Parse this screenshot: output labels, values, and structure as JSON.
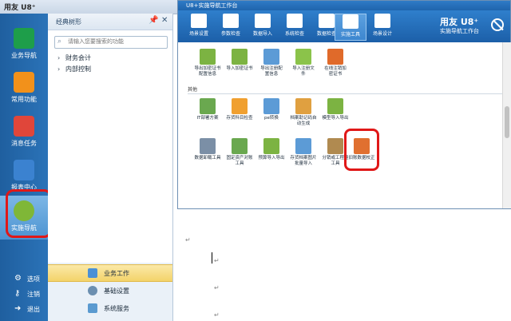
{
  "app": {
    "logo": "用友 U8⁺"
  },
  "rail": {
    "items": [
      {
        "label": "业务导航",
        "icon": "nav-icon",
        "color": "#1e9e4a"
      },
      {
        "label": "常用功能",
        "icon": "star-icon",
        "color": "#f2911b"
      },
      {
        "label": "消息任务",
        "icon": "message-icon",
        "color": "#e0463a"
      },
      {
        "label": "报表中心",
        "icon": "report-icon",
        "color": "#3b82d0"
      },
      {
        "label": "实施导航",
        "icon": "compass-icon",
        "color": "#7fb737"
      }
    ],
    "bottom": [
      {
        "label": "选项",
        "icon": "gear-icon"
      },
      {
        "label": "注销",
        "icon": "key-icon"
      },
      {
        "label": "退出",
        "icon": "exit-icon"
      }
    ]
  },
  "nav": {
    "title": "经典树形",
    "search_placeholder": "请输入您要搜索的功能",
    "tree": [
      {
        "label": "财务会计"
      },
      {
        "label": "内部控制"
      }
    ],
    "bottom": [
      {
        "label": "业务工作",
        "color": "#4a90d6"
      },
      {
        "label": "基础设置",
        "color": "#6b8fb0"
      },
      {
        "label": "系统服务",
        "color": "#5a9ad0"
      }
    ]
  },
  "workbench": {
    "title": "U8+实施导航工作台",
    "brand1": "用友 U8⁺",
    "brand2": "实施导航工作台",
    "toolbar": [
      {
        "label": "场景设置"
      },
      {
        "label": "参数检查"
      },
      {
        "label": "数据导入"
      },
      {
        "label": "系统检查"
      },
      {
        "label": "数据检查"
      },
      {
        "label": "实施工具"
      },
      {
        "label": "场景设计"
      }
    ],
    "tools_top": [
      {
        "label": "导出加密证书\n配置信息",
        "color": "#7cb342"
      },
      {
        "label": "导入加密证书",
        "color": "#7cb342"
      },
      {
        "label": "导出注册配\n置信息",
        "color": "#5c9bd6"
      },
      {
        "label": "导入注册文\n件",
        "color": "#8bc34a"
      },
      {
        "label": "在线注销加\n密证书",
        "color": "#e06a2a"
      }
    ],
    "section_other": "其他",
    "tools_row2": [
      {
        "label": "IT部署方案",
        "color": "#6aa84f"
      },
      {
        "label": "存货科目检查",
        "color": "#f0a030"
      },
      {
        "label": "pe转换",
        "color": "#5c9bd6"
      },
      {
        "label": "档案助记码自\n动生成",
        "color": "#e0a040"
      },
      {
        "label": "模型导入导出",
        "color": "#7cb342"
      }
    ],
    "tools_row3": [
      {
        "label": "数据卸载工具",
        "color": "#7b8fa6"
      },
      {
        "label": "固定资产对账\n工具",
        "color": "#6aa84f"
      },
      {
        "label": "预算导入导出",
        "color": "#7cb342"
      },
      {
        "label": "存货档案图片\n批量导入",
        "color": "#5c9bd6"
      },
      {
        "label": "分销或工程量\n工具",
        "color": "#b08a50"
      },
      {
        "label": "旧账数据校正",
        "color": "#e07030"
      }
    ]
  },
  "document": {
    "para_mark": "↵"
  }
}
